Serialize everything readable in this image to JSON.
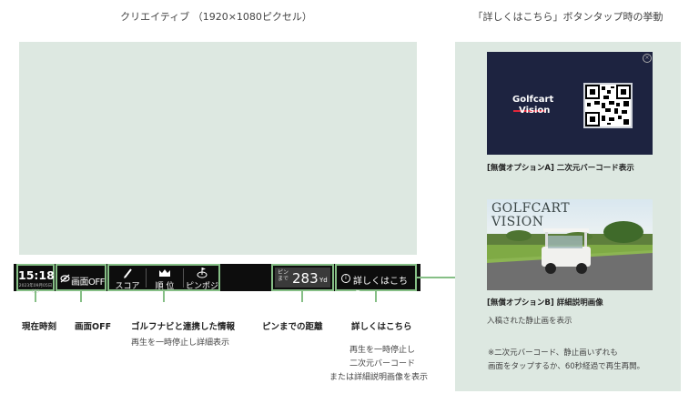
{
  "headings": {
    "creative": "クリエイティブ （1920×1080ピクセル）",
    "behavior": "「詳しくはこちら」ボタンタップ時の挙動"
  },
  "bar": {
    "time": "15:18",
    "date": "2023年09月05日(火)",
    "screen_off": "画面OFF",
    "score": "スコア",
    "rank": "順 位",
    "pin_pos": "ピンポジ",
    "pin_label": "ピンまで",
    "pin_value": "283",
    "pin_unit": "Yd",
    "details": "詳しくはこちら"
  },
  "labels": {
    "time": "現在時刻",
    "screen_off": "画面OFF",
    "golf_nav": "ゴルフナビと連携した情報",
    "golf_nav_sub": "再生を一時停止し詳細表示",
    "pin_dist": "ピンまでの距離",
    "details": "詳しくはこちら",
    "details_sub1": "再生を一時停止し",
    "details_sub2": "二次元バーコード",
    "details_sub3": "または詳細説明画像を表示"
  },
  "panel": {
    "brand_a_line1": "Golfcart",
    "brand_a_line2": "Vision",
    "caption_a": "[無償オプションA] 二次元バーコード表示",
    "brand_b_line1": "GOLFCART",
    "brand_b_line2": "VISION",
    "caption_b": "[無償オプションB] 詳細説明画像",
    "caption_b_sub": "入稿された静止画を表示",
    "note_line1": "※二次元バーコード、静止画いずれも",
    "note_line2": "画面をタップするか、60秒経過で再生再開。"
  },
  "icons": {
    "screen_off": "eye-off-icon",
    "score": "pencil-icon",
    "rank": "crown-icon",
    "pin_pos": "pin-flag-icon",
    "details": "info-icon",
    "close": "close-icon"
  },
  "colors": {
    "highlight": "#86bf86",
    "panel_bg": "#dde8e1",
    "bar_bg": "#0d0d0d",
    "qr_bg": "#1d2340"
  }
}
